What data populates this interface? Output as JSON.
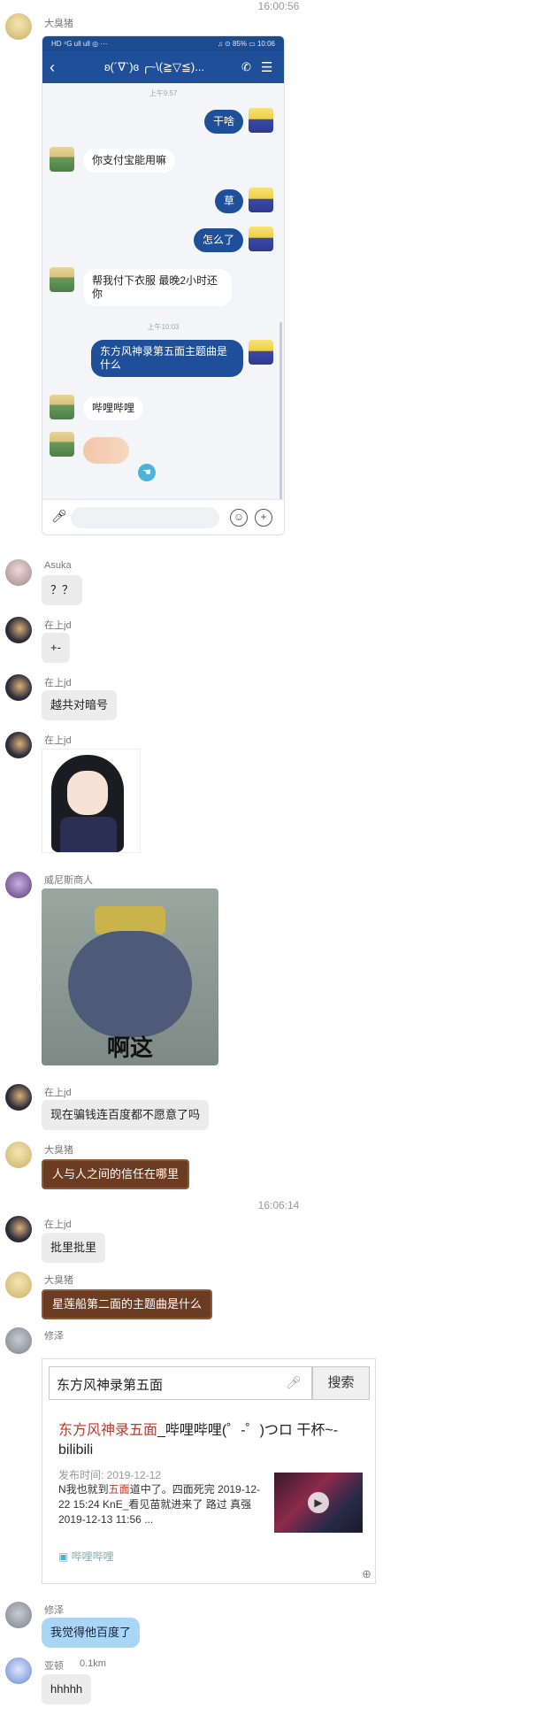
{
  "timestamps": {
    "t1": "16:00:56",
    "t2": "16:06:14"
  },
  "phone": {
    "status_left": "HD ⁴G ull ull ◎ ⋯",
    "status_right": "♫ ⊙ 85% ▭ 10:06",
    "title": "ʚ(´∇`)ɞ  ╭~\\(≧▽≦)...",
    "time1": "上午9:57",
    "time2": "上午10:03",
    "msg1": "干啥",
    "msg2": "你支付宝能用嘛",
    "msg3": "草",
    "msg4": "怎么了",
    "msg5": "帮我付下衣服 最晚2小时还你",
    "msg6": "东方风神录第五面主题曲是什么",
    "msg7": "哔哩哔哩"
  },
  "messages": {
    "m1_name": "大臭猪",
    "m2_name": "Asuka",
    "m2_text": "？？",
    "m3_name": "在上jd",
    "m3_text": "+-",
    "m4_name": "在上jd",
    "m4_text": "越共对暗号",
    "m5_name": "在上jd",
    "m6_name": "威尼斯商人",
    "m6_caption": "啊这",
    "m7_name": "在上jd",
    "m7_text": "现在骗钱连百度都不愿意了吗",
    "m8_name": "大臭猪",
    "m8_text": "人与人之间的信任在哪里",
    "m9_name": "在上jd",
    "m9_text": "批里批里",
    "m10_name": "大臭猪",
    "m10_text": "星莲船第二面的主题曲是什么",
    "m11_name": "修泽",
    "m12_name": "修泽",
    "m12_text": "我觉得他百度了",
    "m13_name": "亚顿",
    "m13_dist": "0.1km",
    "m13_text": "hhhhh"
  },
  "baidu": {
    "query": "东方风神录第五面",
    "button": "搜索",
    "title_hl": "东方风神录五面",
    "title_rest": "_哔哩哔哩(゜-゜)つロ 干杯~-bilibili",
    "date": "发布时间: 2019-12-12",
    "snippet_a": "N我也就到",
    "snippet_hl": "五面",
    "snippet_b": "道中了。四面死完 2019-12-22 15:24 KnE_看见苗就进来了 路过 真强 2019-12-13 11:56 ...",
    "source": "哔哩哔哩"
  },
  "colors": {
    "phone_bar": "#1f4f98",
    "brown_bubble": "#6b3b22",
    "blue_bubble": "#a9d6f7",
    "highlight": "#c0392b"
  }
}
